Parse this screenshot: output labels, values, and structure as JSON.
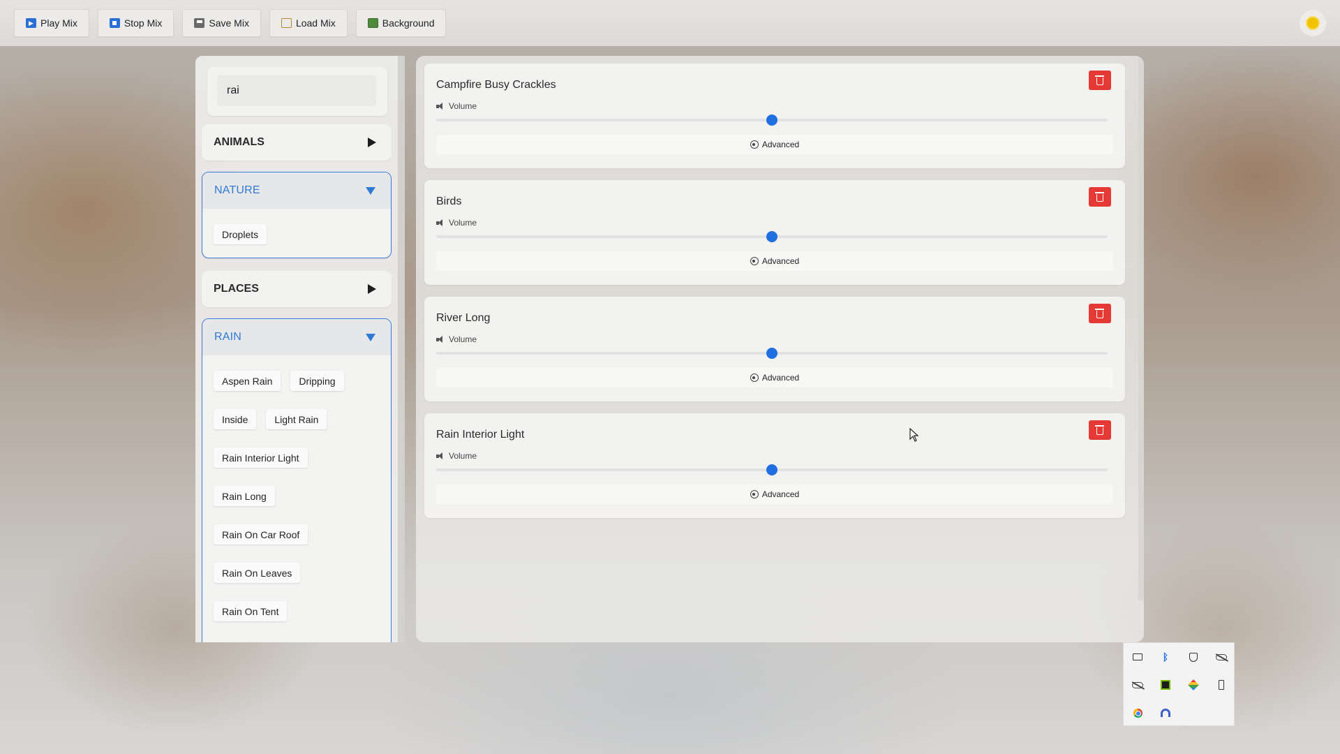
{
  "toolbar": {
    "buttons": [
      {
        "label": "Play Mix",
        "icon": "play-mix-icon"
      },
      {
        "label": "Stop Mix",
        "icon": "stop-icon"
      },
      {
        "label": "Save Mix",
        "icon": "save-icon"
      },
      {
        "label": "Load Mix",
        "icon": "folder-icon"
      },
      {
        "label": "Background",
        "icon": "image-icon"
      }
    ],
    "theme_toggle_icon": "sun-icon"
  },
  "sidebar": {
    "search": {
      "value": "rai"
    },
    "categories": [
      {
        "name": "ANIMALS",
        "expanded": false,
        "items": []
      },
      {
        "name": "NATURE",
        "expanded": true,
        "items": [
          "Droplets"
        ]
      },
      {
        "name": "PLACES",
        "expanded": false,
        "items": []
      },
      {
        "name": "RAIN",
        "expanded": true,
        "items": [
          "Aspen Rain",
          "Dripping",
          "Inside",
          "Light Rain",
          "Rain Interior Light",
          "Rain Long",
          "Rain On Car Roof",
          "Rain On Leaves",
          "Rain On Tent"
        ]
      }
    ]
  },
  "mix": {
    "tracks": [
      {
        "title": "Campfire Busy Crackles",
        "volume_label": "Volume",
        "volume": 0.5,
        "advanced_label": "Advanced"
      },
      {
        "title": "Birds",
        "volume_label": "Volume",
        "volume": 0.5,
        "advanced_label": "Advanced"
      },
      {
        "title": "River Long",
        "volume_label": "Volume",
        "volume": 0.5,
        "advanced_label": "Advanced"
      },
      {
        "title": "Rain Interior Light",
        "volume_label": "Volume",
        "volume": 0.5,
        "advanced_label": "Advanced"
      }
    ]
  },
  "tray": {
    "icons": [
      "monitor-icon",
      "bluetooth-icon",
      "shield-icon",
      "cloud-offline-icon",
      "cloud-offline-icon",
      "nvidia-icon",
      "layers-icon",
      "usb-icon",
      "chrome-icon",
      "arc-icon"
    ]
  },
  "colors": {
    "accent": "#2f7ad6",
    "slider": "#1f6fe0",
    "delete": "#e53935"
  }
}
